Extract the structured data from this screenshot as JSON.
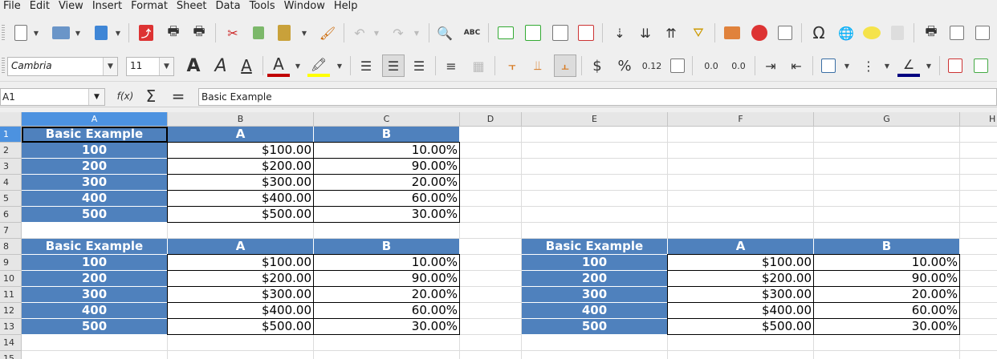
{
  "menu": [
    "File",
    "Edit",
    "View",
    "Insert",
    "Format",
    "Sheet",
    "Data",
    "Tools",
    "Window",
    "Help"
  ],
  "toolbar": {
    "spellcheck_label": "ABC",
    "font_name": "Cambria",
    "font_size": "11",
    "bold_label": "A",
    "italic_label": "A",
    "underline_label": "A",
    "font_color_label": "A",
    "currency_label": "$",
    "percent_label": "%",
    "number_format_label": "0.12",
    "add_decimal_label": "0.0",
    "delete_decimal_label": "0.0",
    "font_color_hex": "#c00000",
    "highlight_color_hex": "#ffff00",
    "border_color_hex": "#000080"
  },
  "formula_bar": {
    "cell_ref": "A1",
    "function_wizard_label": "f(x)",
    "sum_label": "Σ",
    "formula_label": "=",
    "content": "Basic Example"
  },
  "columns": [
    "A",
    "B",
    "C",
    "D",
    "E",
    "F",
    "G",
    "H"
  ],
  "rows": [
    "1",
    "2",
    "3",
    "4",
    "5",
    "6",
    "7",
    "8",
    "9",
    "10",
    "11",
    "12",
    "13",
    "14",
    "15"
  ],
  "tables": [
    {
      "headers": [
        "Basic Example",
        "A",
        "B"
      ],
      "rows": [
        [
          "100",
          "$100.00",
          "10.00%"
        ],
        [
          "200",
          "$200.00",
          "90.00%"
        ],
        [
          "300",
          "$300.00",
          "20.00%"
        ],
        [
          "400",
          "$400.00",
          "60.00%"
        ],
        [
          "500",
          "$500.00",
          "30.00%"
        ]
      ]
    },
    {
      "headers": [
        "Basic Example",
        "A",
        "B"
      ],
      "rows": [
        [
          "100",
          "$100.00",
          "10.00%"
        ],
        [
          "200",
          "$200.00",
          "90.00%"
        ],
        [
          "300",
          "$300.00",
          "20.00%"
        ],
        [
          "400",
          "$400.00",
          "60.00%"
        ],
        [
          "500",
          "$500.00",
          "30.00%"
        ]
      ]
    },
    {
      "headers": [
        "Basic Example",
        "A",
        "B"
      ],
      "rows": [
        [
          "100",
          "$100.00",
          "10.00%"
        ],
        [
          "200",
          "$200.00",
          "90.00%"
        ],
        [
          "300",
          "$300.00",
          "20.00%"
        ],
        [
          "400",
          "$400.00",
          "60.00%"
        ],
        [
          "500",
          "$500.00",
          "30.00%"
        ]
      ]
    }
  ],
  "colors": {
    "table_header": "#4f81bd",
    "selection": "#4c92e0"
  }
}
